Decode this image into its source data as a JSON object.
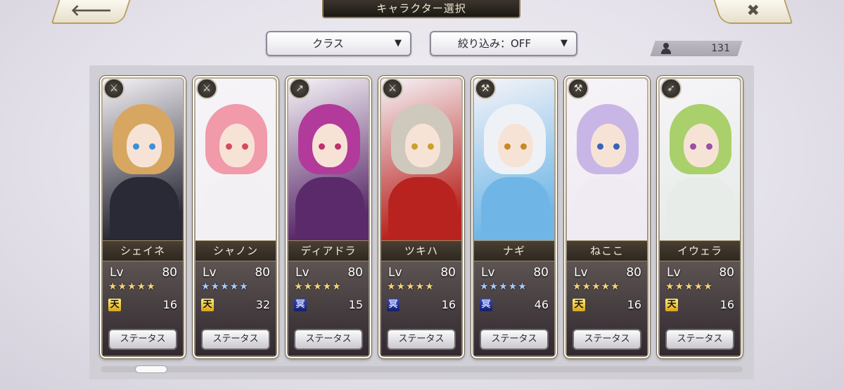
{
  "header": {
    "title": "キャラクター選択",
    "back_icon": "🡐",
    "close_icon": "✖"
  },
  "filters": {
    "class_label": "クラス",
    "filter_label": "絞り込み：OFF",
    "caret": "▼"
  },
  "roster_count": "131",
  "characters": [
    {
      "name": "シェイネ",
      "lv_label": "Lv",
      "level": "80",
      "stars": "★★★★★",
      "star_color": "gold",
      "rank": "天",
      "rank_type": "ten",
      "value": "16",
      "class_icon": "sword-icon",
      "status": "ステータス",
      "hair": "#d7a661",
      "body": "#2a2a36",
      "eye": "#3d8fd9"
    },
    {
      "name": "シャノン",
      "lv_label": "Lv",
      "level": "80",
      "stars": "★★★★★",
      "star_color": "blue",
      "rank": "天",
      "rank_type": "ten",
      "value": "32",
      "class_icon": "sword-icon",
      "status": "ステータス",
      "hair": "#f09aaa",
      "body": "#f2f0f2",
      "eye": "#d64b5a"
    },
    {
      "name": "ディアドラ",
      "lv_label": "Lv",
      "level": "80",
      "stars": "★★★★★",
      "star_color": "gold",
      "rank": "冥",
      "rank_type": "mei",
      "value": "15",
      "class_icon": "spear-icon",
      "status": "ステータス",
      "hair": "#b23a9a",
      "body": "#5a2a6a",
      "eye": "#c0306a"
    },
    {
      "name": "ツキハ",
      "lv_label": "Lv",
      "level": "80",
      "stars": "★★★★★",
      "star_color": "gold",
      "rank": "冥",
      "rank_type": "mei",
      "value": "16",
      "class_icon": "sword-icon",
      "status": "ステータス",
      "hair": "#cfc9bd",
      "body": "#b8231f",
      "eye": "#c9a12a"
    },
    {
      "name": "ナギ",
      "lv_label": "Lv",
      "level": "80",
      "stars": "★★★★★",
      "star_color": "blue",
      "rank": "冥",
      "rank_type": "mei",
      "value": "46",
      "class_icon": "axe-icon",
      "status": "ステータス",
      "hair": "#eef2f6",
      "body": "#6fb6e6",
      "eye": "#c98a24"
    },
    {
      "name": "ねここ",
      "lv_label": "Lv",
      "level": "80",
      "stars": "★★★★★",
      "star_color": "gold",
      "rank": "天",
      "rank_type": "ten",
      "value": "16",
      "class_icon": "axe-icon",
      "status": "ステータス",
      "hair": "#c8b6e6",
      "body": "#f0eaf2",
      "eye": "#3a62b8"
    },
    {
      "name": "イウェラ",
      "lv_label": "Lv",
      "level": "80",
      "stars": "★★★★★",
      "star_color": "gold",
      "rank": "天",
      "rank_type": "ten",
      "value": "16",
      "class_icon": "bow-icon",
      "status": "ステータス",
      "hair": "#a9d06a",
      "body": "#e8ece9",
      "eye": "#9a4fa8"
    }
  ]
}
